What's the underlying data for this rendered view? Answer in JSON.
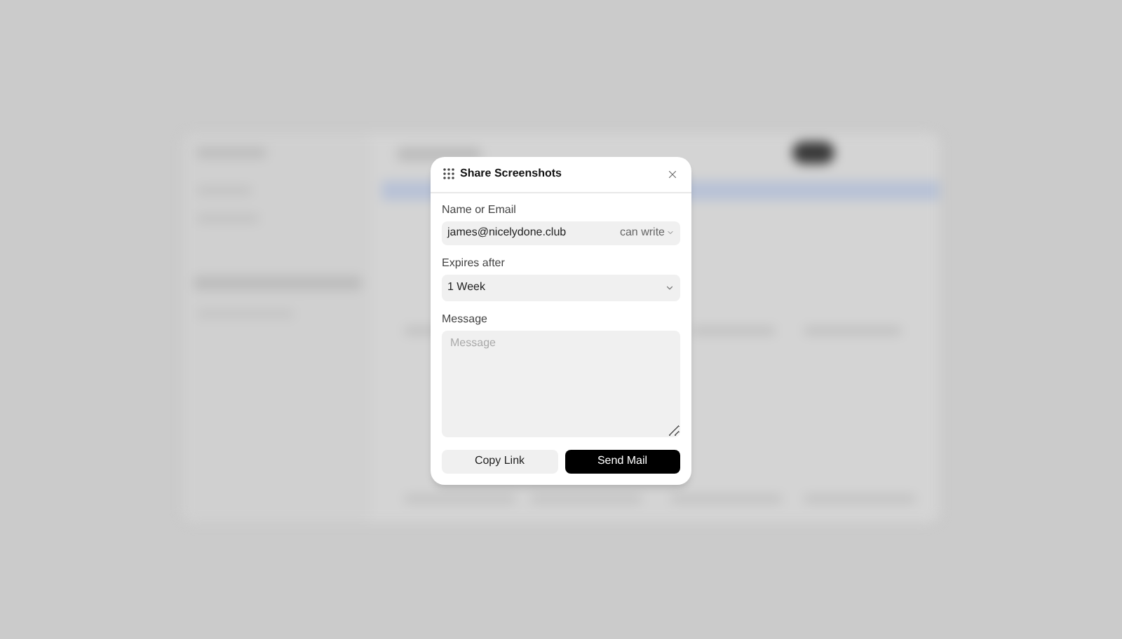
{
  "dialog": {
    "title": "Share Screenshots",
    "recipient": {
      "label": "Name or Email",
      "value": "james@nicelydone.club",
      "permission": "can write"
    },
    "expiry": {
      "label": "Expires after",
      "value": "1 Week"
    },
    "message": {
      "label": "Message",
      "placeholder": "Message"
    },
    "buttons": [
      {
        "label": "Copy Link",
        "kind": "secondary"
      },
      {
        "label": "Send Mail",
        "kind": "primary"
      }
    ]
  }
}
